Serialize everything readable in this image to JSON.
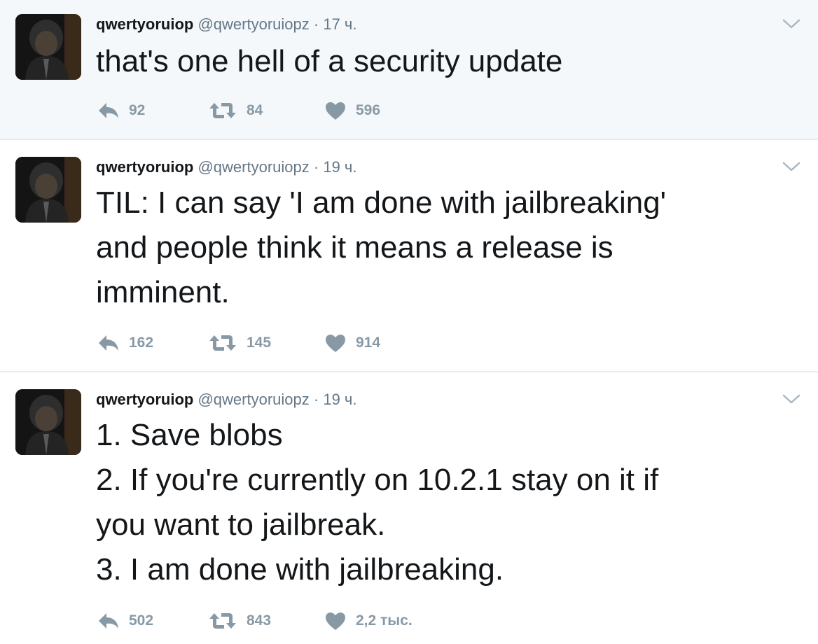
{
  "colors": {
    "highlight_bg": "#f5f8fa",
    "name": "#14171a",
    "meta": "#657786",
    "action": "#8899a6",
    "divider": "#e6ecf0"
  },
  "icons": {
    "reply": "reply-arrow-icon",
    "retweet": "retweet-icon",
    "like": "heart-icon",
    "menu": "chevron-down-icon",
    "avatar": "profile-photo"
  },
  "tweets": [
    {
      "name": "qwertyoruiop",
      "handle": "@qwertyoruiopz",
      "separator": "·",
      "time": "17 ч.",
      "lines": [
        "that's one hell of a security update"
      ],
      "replies": "92",
      "retweets": "84",
      "likes": "596"
    },
    {
      "name": "qwertyoruiop",
      "handle": "@qwertyoruiopz",
      "separator": "·",
      "time": "19 ч.",
      "lines": [
        "TIL: I can say 'I am done with jailbreaking'",
        "and people think it means a release is",
        "imminent."
      ],
      "replies": "162",
      "retweets": "145",
      "likes": "914"
    },
    {
      "name": "qwertyoruiop",
      "handle": "@qwertyoruiopz",
      "separator": "·",
      "time": "19 ч.",
      "lines": [
        "1. Save blobs",
        "2. If you're currently on 10.2.1 stay on it if",
        "you want to jailbreak.",
        "3. I am done with jailbreaking."
      ],
      "replies": "502",
      "retweets": "843",
      "likes": "2,2 тыс."
    }
  ]
}
